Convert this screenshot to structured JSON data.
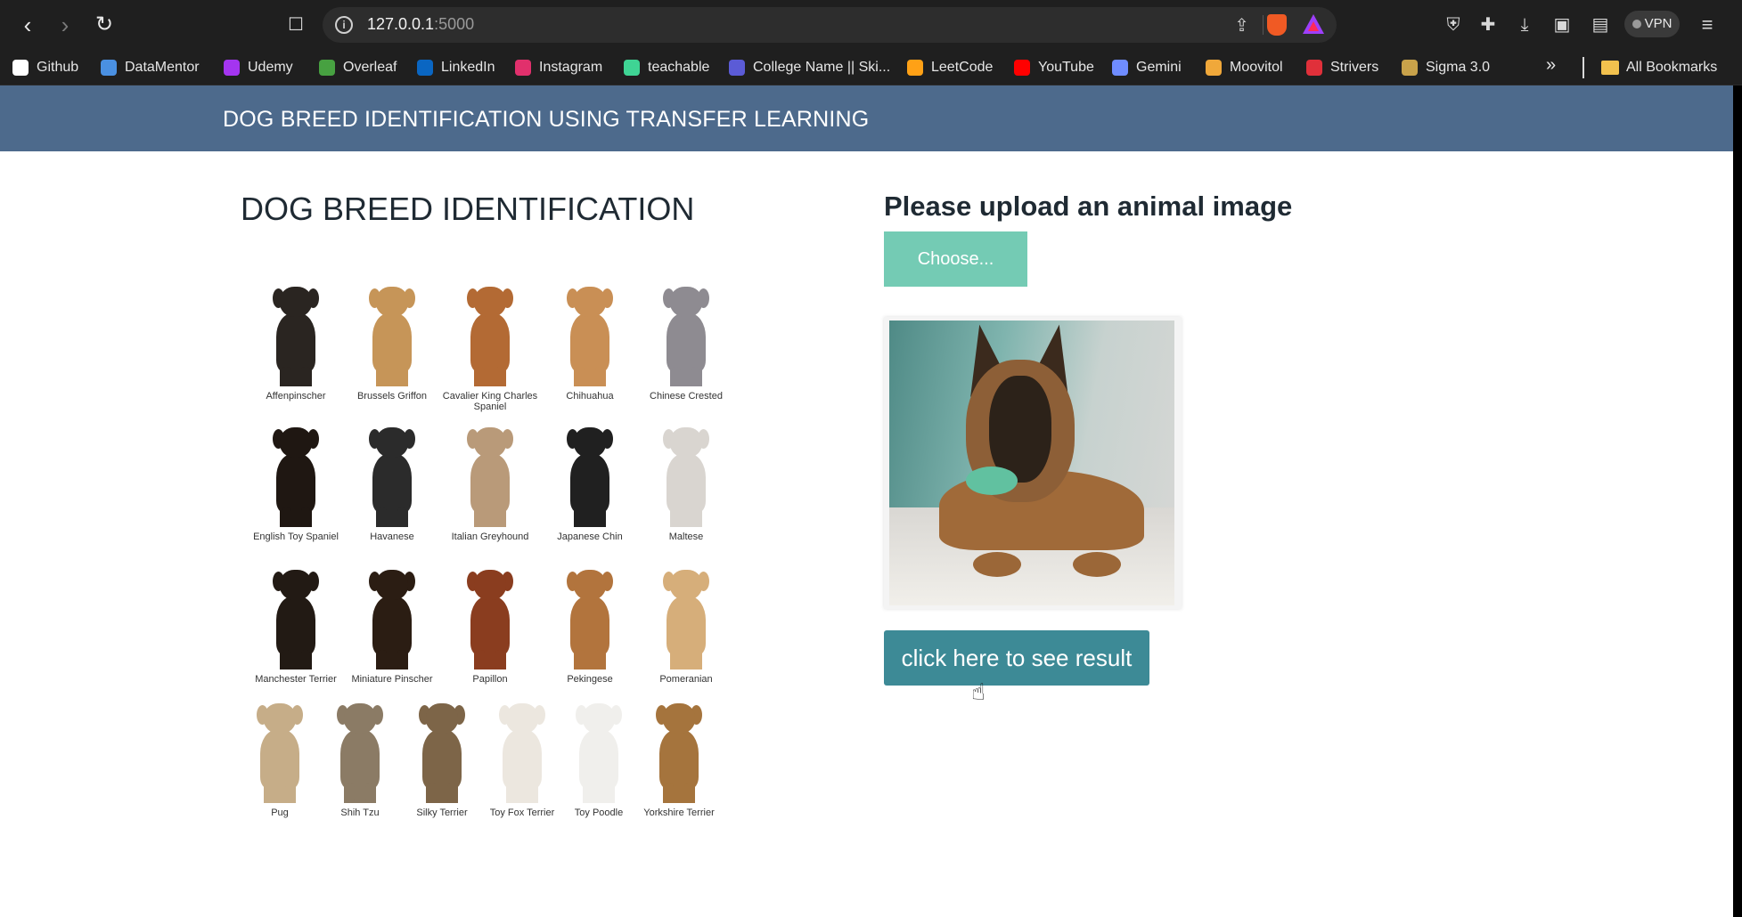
{
  "browser": {
    "url_host": "127.0.0.1",
    "url_port": ":5000",
    "vpn_label": "VPN",
    "icons": [
      "back-arrow-icon",
      "forward-arrow-icon",
      "reload-icon",
      "bookmark-icon",
      "site-info-icon",
      "share-icon",
      "brave-shields-icon",
      "brave-rewards-icon",
      "shield-icon",
      "extensions-icon",
      "download-icon",
      "sidebar-icon",
      "wallet-icon",
      "menu-icon"
    ]
  },
  "bookmarks": {
    "items": [
      {
        "label": "Github",
        "icon": "github-icon",
        "color": "#ffffff"
      },
      {
        "label": "DataMentor",
        "icon": "datamentor-icon",
        "color": "#4a90e2"
      },
      {
        "label": "Udemy",
        "icon": "udemy-icon",
        "color": "#a435f0"
      },
      {
        "label": "Overleaf",
        "icon": "overleaf-icon",
        "color": "#47a141"
      },
      {
        "label": "LinkedIn",
        "icon": "linkedin-icon",
        "color": "#0a66c2"
      },
      {
        "label": "Instagram",
        "icon": "instagram-icon",
        "color": "#e1306c"
      },
      {
        "label": "teachable",
        "icon": "teachable-icon",
        "color": "#3fd494"
      },
      {
        "label": "College Name || Ski...",
        "icon": "college-icon",
        "color": "#5b5bd6"
      },
      {
        "label": "LeetCode",
        "icon": "leetcode-icon",
        "color": "#ffa116"
      },
      {
        "label": "YouTube",
        "icon": "youtube-icon",
        "color": "#ff0000"
      },
      {
        "label": "Gemini",
        "icon": "gemini-icon",
        "color": "#6f8cff"
      },
      {
        "label": "Moovitol",
        "icon": "moovitol-icon",
        "color": "#f0a83a"
      },
      {
        "label": "Strivers",
        "icon": "strivers-icon",
        "color": "#e0303a"
      },
      {
        "label": "Sigma 3.0",
        "icon": "sigma-icon",
        "color": "#c8a24a"
      }
    ],
    "all_bookmarks": "All Bookmarks"
  },
  "app": {
    "nav_title": "DOG BREED IDENTIFICATION USING TRANSFER LEARNING",
    "left_heading": "DOG BREED IDENTIFICATION",
    "upload_heading": "Please upload an animal image",
    "choose_button": "Choose...",
    "result_button": "click here to see result",
    "nav_color": "#4d6a8c",
    "choose_color": "#74cbb4",
    "result_color": "#3d8a96"
  },
  "breeds": [
    {
      "name": "Affenpinscher",
      "color": "#2a2521"
    },
    {
      "name": "Brussels Griffon",
      "color": "#c69558"
    },
    {
      "name": "Cavalier King Charles Spaniel",
      "color": "#b36a34"
    },
    {
      "name": "Chihuahua",
      "color": "#c98f55"
    },
    {
      "name": "Chinese Crested",
      "color": "#8e8b91"
    },
    {
      "name": "English Toy Spaniel",
      "color": "#1f1712"
    },
    {
      "name": "Havanese",
      "color": "#2b2b2b"
    },
    {
      "name": "Italian Greyhound",
      "color": "#b99a79"
    },
    {
      "name": "Japanese Chin",
      "color": "#202020"
    },
    {
      "name": "Maltese",
      "color": "#d9d5d0"
    },
    {
      "name": "Manchester Terrier",
      "color": "#221a14"
    },
    {
      "name": "Miniature Pinscher",
      "color": "#2b1d13"
    },
    {
      "name": "Papillon",
      "color": "#8a3d1f"
    },
    {
      "name": "Pekingese",
      "color": "#b2743d"
    },
    {
      "name": "Pomeranian",
      "color": "#d6ae7a"
    },
    {
      "name": "Pug",
      "color": "#c6ad88"
    },
    {
      "name": "Shih Tzu",
      "color": "#8b7b65"
    },
    {
      "name": "Silky Terrier",
      "color": "#7d6548"
    },
    {
      "name": "Toy Fox Terrier",
      "color": "#ece7df"
    },
    {
      "name": "Toy Poodle",
      "color": "#f0efec"
    },
    {
      "name": "Yorkshire Terrier",
      "color": "#a5743d"
    }
  ]
}
